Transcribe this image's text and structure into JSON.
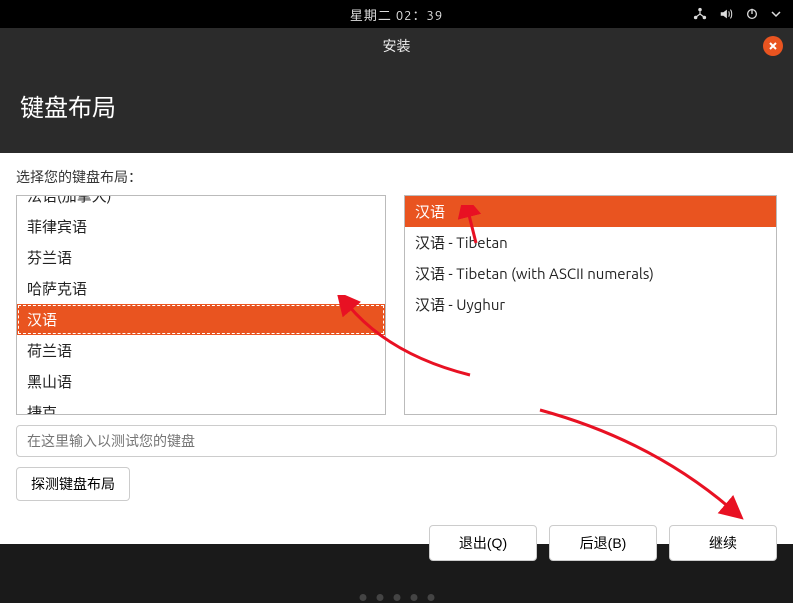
{
  "topbar": {
    "time": "星期二 02：39"
  },
  "titlebar": {
    "title": "安装"
  },
  "header": {
    "title": "键盘布局"
  },
  "prompt": "选择您的键盘布局：",
  "leftList": {
    "cutItem": "法语(加拿大)",
    "items": [
      "菲律宾语",
      "芬兰语",
      "哈萨克语",
      "汉语",
      "荷兰语",
      "黑山语",
      "捷克"
    ],
    "selectedIndex": 3
  },
  "rightList": {
    "items": [
      "汉语",
      "汉语 - Tibetan",
      "汉语 - Tibetan (with ASCII numerals)",
      "汉语 - Uyghur"
    ],
    "selectedIndex": 0
  },
  "testInput": {
    "placeholder": "在这里输入以测试您的键盘"
  },
  "detectButton": {
    "label": "探测键盘布局"
  },
  "footer": {
    "quit": "退出(Q)",
    "back": "后退(B)",
    "continue": "继续"
  }
}
